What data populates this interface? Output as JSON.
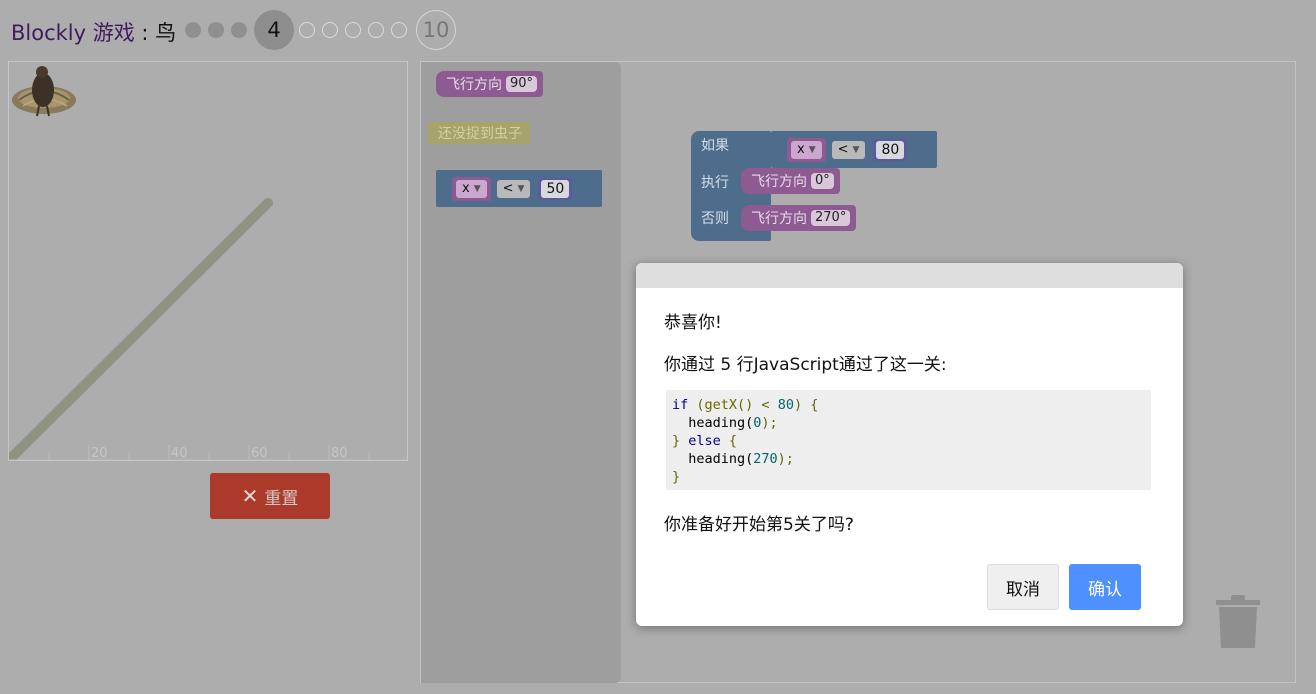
{
  "header": {
    "brand": "Blockly 游戏",
    "separator": " : ",
    "game": "鸟",
    "current_level": "4",
    "last_level": "10"
  },
  "visualization": {
    "x_ticks": [
      "20",
      "40",
      "60",
      "80"
    ]
  },
  "reset_button": {
    "label": "重置"
  },
  "flyout": {
    "heading_label": "飞行方向",
    "heading_value": "90°",
    "no_worm_label": "还没捉到虫子",
    "compare_var": "x",
    "compare_op": "<",
    "compare_value": "50"
  },
  "workspace": {
    "if_label": "如果",
    "do_label": "执行",
    "else_label": "否则",
    "cond_var": "x",
    "cond_op": "<",
    "cond_value": "80",
    "do_heading_label": "飞行方向",
    "do_heading_value": "0°",
    "else_heading_label": "飞行方向",
    "else_heading_value": "270°"
  },
  "dialog": {
    "congrats": "恭喜你!",
    "summary": "你通过 5 行JavaScript通过了这一关:",
    "code": {
      "l1_kw": "if",
      "l1_a": " (getX() ",
      "l1_op": "<",
      "l1_num": " 80",
      "l1_b": ") {",
      "l2_a": "  heading(",
      "l2_num": "0",
      "l2_b": ");",
      "l3_a": "} ",
      "l3_kw": "else",
      "l3_b": " {",
      "l4_a": "  heading(",
      "l4_num": "270",
      "l4_b": ");",
      "l5": "}"
    },
    "question": "你准备好开始第5关了吗?",
    "cancel_label": "取消",
    "ok_label": "确认"
  },
  "colors": {
    "brand_purple": "#3f1d5c",
    "reset_red": "#ac3a2a",
    "ok_blue": "#4d90fe",
    "heading_block": "#8d5a92",
    "logic_block": "#4e6d8d"
  }
}
